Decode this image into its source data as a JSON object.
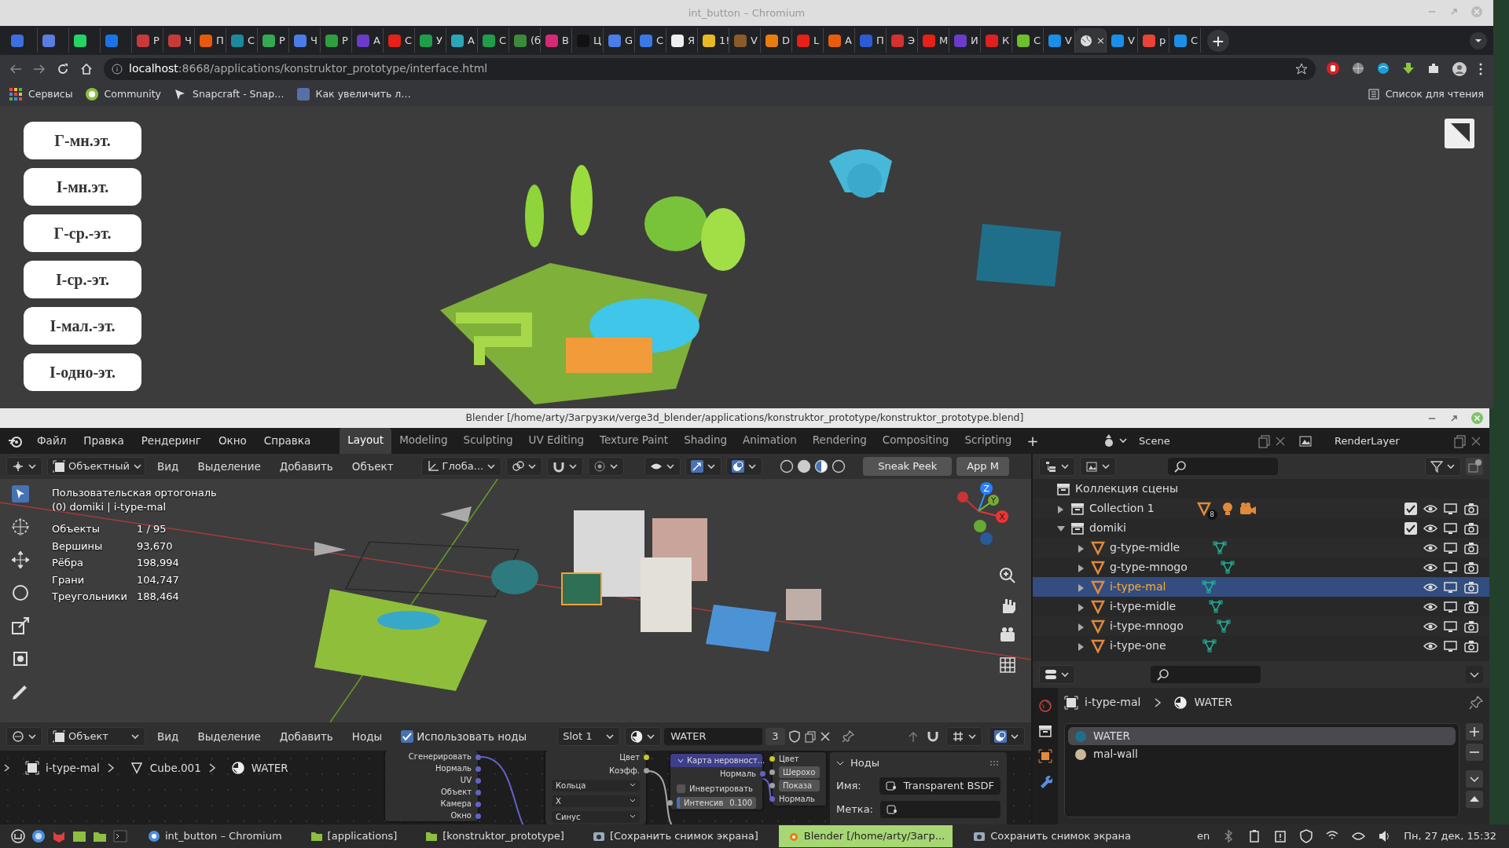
{
  "browser": {
    "title": "int_button – Chromium",
    "tabs": [
      {
        "color": "#3d6fe0",
        "selected": false
      },
      {
        "color": "#5a7de0",
        "selected": false
      },
      {
        "color": "#25d366",
        "selected": false
      },
      {
        "color": "#1a73e8",
        "selected": false
      },
      {
        "label": "Р",
        "color": "#c83a3a",
        "selected": false
      },
      {
        "label": "Ч",
        "color": "#c83a3a",
        "selected": false
      },
      {
        "label": "П",
        "color": "#e8590c",
        "selected": false
      },
      {
        "label": "С",
        "color": "#1b8a9c",
        "selected": false
      },
      {
        "label": "Р",
        "color": "#34a853",
        "selected": false
      },
      {
        "label": "Ч",
        "color": "#4a7de8",
        "selected": false
      },
      {
        "label": "Р",
        "color": "#2e9e3e",
        "selected": false
      },
      {
        "label": "А",
        "color": "#6a3cc8",
        "selected": false
      },
      {
        "label": "С",
        "color": "#e62117",
        "selected": false
      },
      {
        "label": "У",
        "color": "#1e9e4a",
        "selected": false
      },
      {
        "label": "А",
        "color": "#2aa6b8",
        "selected": false
      },
      {
        "label": "С",
        "color": "#1e9e4a",
        "selected": false
      },
      {
        "label": "(б",
        "color": "#3a8a3a",
        "selected": false
      },
      {
        "label": "В",
        "color": "#d62976",
        "selected": false
      },
      {
        "label": "Ц",
        "color": "#111111",
        "selected": false
      },
      {
        "label": "G",
        "color": "#4a7de8",
        "selected": false
      },
      {
        "label": "С",
        "color": "#3b78e7",
        "selected": false
      },
      {
        "label": "Я",
        "color": "#eeeeee",
        "selected": false
      },
      {
        "label": "1!",
        "color": "#e8b923",
        "selected": false
      },
      {
        "label": "V",
        "color": "#8b5a2b",
        "selected": false
      },
      {
        "label": "D",
        "color": "#e87d0d",
        "selected": false
      },
      {
        "label": "L",
        "color": "#e62117",
        "selected": false
      },
      {
        "label": "А",
        "color": "#e85d0d",
        "selected": false
      },
      {
        "label": "П",
        "color": "#2d5bd6",
        "selected": false
      },
      {
        "label": "Э",
        "color": "#d63030",
        "selected": false
      },
      {
        "label": "М",
        "color": "#e62117",
        "selected": false
      },
      {
        "label": "И",
        "color": "#6a3cc8",
        "selected": false
      },
      {
        "label": "К",
        "color": "#e02020",
        "selected": false
      },
      {
        "label": "С",
        "color": "#6fbf2a",
        "selected": false
      },
      {
        "label": "V",
        "color": "#1a8fe8",
        "selected": false
      },
      {
        "label": "×",
        "color": "#dddddd",
        "selected": true
      },
      {
        "label": "V",
        "color": "#1a8fe8",
        "selected": false
      },
      {
        "label": "р",
        "color": "#ea4335",
        "selected": false
      },
      {
        "label": "С",
        "color": "#1a8fe8",
        "selected": false
      }
    ],
    "new_tab": "+",
    "url": {
      "host": "localhost",
      "path": ":8668/applications/konstruktor_prototype/interface.html"
    },
    "bookmarks": [
      "Сервисы",
      "Community",
      "Snapcraft - Snap…",
      "Как увеличить л…"
    ],
    "reading_list": "Список для чтения"
  },
  "page": {
    "buttons": [
      "Г-мн.эт.",
      "I-мн.эт.",
      "Г-ср.-эт.",
      "I-ср.-эт.",
      "I-мал.-эт.",
      "I-одно-эт."
    ]
  },
  "blender": {
    "title": "Blender [/home/arty/Загрузки/verge3d_blender/applications/konstruktor_prototype/konstruktor_prototype.blend]",
    "menu": [
      "Файл",
      "Правка",
      "Рендеринг",
      "Окно",
      "Справка"
    ],
    "workspaces": [
      {
        "label": "Layout",
        "selected": true
      },
      {
        "label": "Modeling",
        "selected": false
      },
      {
        "label": "Sculpting",
        "selected": false
      },
      {
        "label": "UV Editing",
        "selected": false
      },
      {
        "label": "Texture Paint",
        "selected": false
      },
      {
        "label": "Shading",
        "selected": false
      },
      {
        "label": "Animation",
        "selected": false
      },
      {
        "label": "Rendering",
        "selected": false
      },
      {
        "label": "Compositing",
        "selected": false
      },
      {
        "label": "Scripting",
        "selected": false
      }
    ],
    "add_workspace": "+",
    "scene": "Scene",
    "view_layer": "RenderLayer",
    "viewport": {
      "mode": "Объектный",
      "menu": [
        "Вид",
        "Выделение",
        "Добавить",
        "Объект"
      ],
      "orientation": "Глоба...",
      "buttons": [
        "Sneak Peek",
        "App M"
      ],
      "view_name": "Пользовательская ортогональ",
      "context": "(0) domiki | i-type-mal",
      "stats": [
        {
          "label": "Объекты",
          "value": "1 / 95"
        },
        {
          "label": "Вершины",
          "value": "93,670"
        },
        {
          "label": "Рёбра",
          "value": "198,994"
        },
        {
          "label": "Грани",
          "value": "104,747"
        },
        {
          "label": "Треугольники",
          "value": "188,464"
        }
      ],
      "gizmo_axes": [
        "Z",
        "Y",
        "X"
      ]
    },
    "outliner": {
      "root": "Коллекция сцены",
      "items": [
        {
          "kind": "collection",
          "name": "Collection 1",
          "badge": "8",
          "expanded": false,
          "checked": true,
          "selected": false
        },
        {
          "kind": "collection",
          "name": "domiki",
          "expanded": true,
          "checked": true,
          "selected": false,
          "children": [
            {
              "kind": "object",
              "name": "g-type-midle",
              "selected": false
            },
            {
              "kind": "object",
              "name": "g-type-mnogo",
              "selected": false
            },
            {
              "kind": "object",
              "name": "i-type-mal",
              "selected": true
            },
            {
              "kind": "object",
              "name": "i-type-midle",
              "selected": false
            },
            {
              "kind": "object",
              "name": "i-type-mnogo",
              "selected": false
            },
            {
              "kind": "object",
              "name": "i-type-one",
              "selected": false
            }
          ]
        }
      ]
    },
    "properties": {
      "breadcrumb": [
        "i-type-mal",
        "WATER"
      ],
      "materials": [
        {
          "name": "WATER",
          "selected": true,
          "color": "#1f6f8a"
        },
        {
          "name": "mal-wall",
          "selected": false,
          "color": "#c9b99a"
        }
      ]
    },
    "node_editor": {
      "mode": "Объект",
      "menu": [
        "Вид",
        "Выделение",
        "Добавить",
        "Ноды"
      ],
      "use_nodes": {
        "label": "Использовать ноды",
        "checked": true
      },
      "slot": "Slot 1",
      "material": "WATER",
      "users": "3",
      "breadcrumb": [
        "i-type-mal",
        "Cube.001",
        "WATER"
      ],
      "nodes": [
        {
          "rows": [
            {
              "kind": "output",
              "label": "Сгенерировать"
            },
            {
              "kind": "output",
              "label": "Нормаль"
            },
            {
              "kind": "output",
              "label": "UV"
            },
            {
              "kind": "output",
              "label": "Объект"
            },
            {
              "kind": "output",
              "label": "Камера"
            },
            {
              "kind": "output",
              "label": "Окно"
            }
          ]
        },
        {
          "rows": [
            {
              "kind": "output",
              "label": "Цвет"
            },
            {
              "kind": "output",
              "label": "Коэфф."
            },
            {
              "kind": "dropdown",
              "label": "Кольца"
            },
            {
              "kind": "dropdown",
              "label": "X"
            },
            {
              "kind": "dropdown",
              "label": "Синус"
            }
          ]
        },
        {
          "title": "Карта неровност...",
          "rows": [
            {
              "kind": "output",
              "label": "Нормаль"
            },
            {
              "kind": "checkbox",
              "label": "Инвертировать",
              "checked": false
            },
            {
              "kind": "field",
              "label": "Интенсив",
              "value": "0.100"
            }
          ]
        },
        {
          "rows": [
            {
              "kind": "input",
              "label": "Цвет"
            },
            {
              "kind": "input",
              "label": "Шерохо"
            },
            {
              "kind": "input",
              "label": "Показа"
            },
            {
              "kind": "input",
              "label": "Нормаль"
            }
          ]
        }
      ],
      "sidebar": {
        "title": "Ноды",
        "name_label": "Имя:",
        "name": "Transparent BSDF",
        "label_label": "Метка:"
      }
    }
  },
  "taskbar": {
    "items": [
      {
        "label": "int_button – Chromium",
        "selected": false
      },
      {
        "label": "[applications]",
        "selected": false
      },
      {
        "label": "[konstruktor_prototype]",
        "selected": false
      },
      {
        "label": "[Сохранить снимок экрана]",
        "selected": false
      },
      {
        "label": "Blender [/home/arty/Загр...",
        "selected": true
      },
      {
        "label": "Сохранить снимок экрана",
        "selected": false
      }
    ],
    "lang": "en",
    "clock": "Пн, 27 дек, 15:32"
  }
}
